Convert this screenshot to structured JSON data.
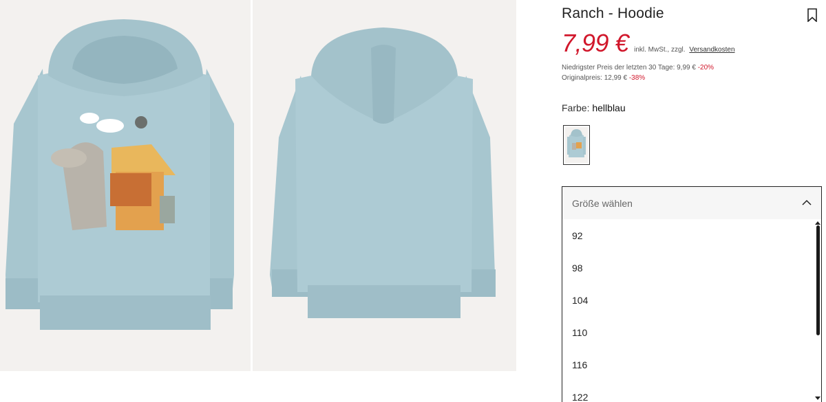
{
  "product": {
    "title": "Ranch - Hoodie",
    "price": "7,99 €",
    "tax_note": "inkl. MwSt., zzgl.",
    "shipping_link": "Versandkosten",
    "lowest_price_label": "Niedrigster Preis der letzten 30 Tage: 9,99 €",
    "lowest_price_discount": "-20%",
    "original_price_label": "Originalpreis: 12,99 €",
    "original_price_discount": "-38%"
  },
  "color": {
    "label": "Farbe:",
    "value": "hellblau"
  },
  "size_selector": {
    "placeholder": "Größe wählen",
    "options": [
      "92",
      "98",
      "104",
      "110",
      "116",
      "122"
    ]
  },
  "icons": {
    "bookmark": "bookmark-icon",
    "chevron": "chevron-up-icon"
  },
  "colors": {
    "price_red": "#d1172b",
    "hoodie_blue": "#a9c8d1",
    "photo_bg": "#f3f1ef"
  }
}
